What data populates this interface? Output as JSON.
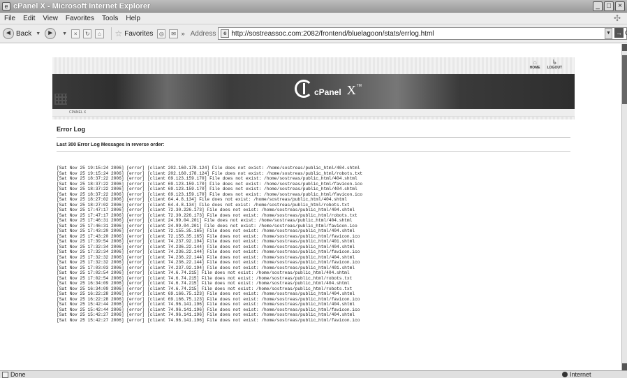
{
  "window": {
    "title": "cPanel X - Microsoft Internet Explorer"
  },
  "menu": [
    "File",
    "Edit",
    "View",
    "Favorites",
    "Tools",
    "Help"
  ],
  "toolbar": {
    "back_label": "Back",
    "favorites_label": "Favorites",
    "address_label": "Address",
    "url": "http://sostreassoc.com:2082/frontend/bluelagoon/stats/errlog.html",
    "go_label": "Go"
  },
  "status": {
    "text": "Done",
    "zone": "Internet"
  },
  "cpanel": {
    "home_label": "HOME",
    "logout_label": "LOGOUT",
    "logo_word": "cPanel",
    "logo_x": "X",
    "logo_tm": "TM",
    "breadcrumb": "CPANEL X",
    "heading": "Error Log",
    "subheading": "Last 300 Error Log Messages in reverse order:"
  },
  "log_lines": [
    "[Sat Nov 25 19:15:24 2006] [error] [client 202.160.178.124] File does not exist: /home/sostreas/public_html/404.shtml",
    "[Sat Nov 25 19:15:24 2006] [error] [client 202.160.178.124] File does not exist: /home/sostreas/public_html/robots.txt",
    "[Sat Nov 25 18:37:22 2006] [error] [client 69.123.159.170] File does not exist: /home/sostreas/public_html/404.shtml",
    "[Sat Nov 25 18:37:22 2006] [error] [client 69.123.159.170] File does not exist: /home/sostreas/public_html/favicon.ico",
    "[Sat Nov 25 18:37:22 2006] [error] [client 69.123.159.170] File does not exist: /home/sostreas/public_html/404.shtml",
    "[Sat Nov 25 18:37:22 2006] [error] [client 69.123.159.170] File does not exist: /home/sostreas/public_html/favicon.ico",
    "[Sat Nov 25 18:27:02 2006] [error] [client 64.4.8.134] File does not exist: /home/sostreas/public_html/404.shtml",
    "[Sat Nov 25 18:27:02 2006] [error] [client 64.4.8.134] File does not exist: /home/sostreas/public_html/robots.txt",
    "[Sat Nov 25 17:47:17 2006] [error] [client 72.30.226.173] File does not exist: /home/sostreas/public_html/404.shtml",
    "[Sat Nov 25 17:47:17 2006] [error] [client 72.30.226.173] File does not exist: /home/sostreas/public_html/robots.txt",
    "[Sat Nov 25 17:46:31 2006] [error] [client 24.99.04.201] File does not exist: /home/sostreas/public_html/404.shtml",
    "[Sat Nov 25 17:46:31 2006] [error] [client 24.99.04.201] File does not exist: /home/sostreas/public_html/favicon.ico",
    "[Sat Nov 25 17:43:20 2006] [error] [client 72.155.35.165] File does not exist: /home/sostreas/public_html/404.shtml",
    "[Sat Nov 25 17:43:20 2006] [error] [client 72.155.35.165] File does not exist: /home/sostreas/public_html/favicon.ico",
    "[Sat Nov 25 17:39:54 2006] [error] [client 74.237.92.194] File does not exist: /home/sostreas/public_html/401.shtml",
    "[Sat Nov 25 17:32:34 2006] [error] [client 74.236.22.144] File does not exist: /home/sostreas/public_html/404.shtml",
    "[Sat Nov 25 17:32:34 2006] [error] [client 74.236.22.144] File does not exist: /home/sostreas/public_html/favicon.ico",
    "[Sat Nov 25 17:32:32 2006] [error] [client 74.236.22.144] File does not exist: /home/sostreas/public_html/404.shtml",
    "[Sat Nov 25 17:32:32 2006] [error] [client 74.236.22.144] File does not exist: /home/sostreas/public_html/favicon.ico",
    "[Sat Nov 25 17:03:03 2006] [error] [client 74.237.92.194] File does not exist: /home/sostreas/public_html/401.shtml",
    "[Sat Nov 25 17:02:54 2006] [error] [client 74.6.74.215] File does not exist: /home/sostreas/public_html/404.shtml",
    "[Sat Nov 25 17:02:54 2006] [error] [client 74.6.74.215] File does not exist: /home/sostreas/public_html/robots.txt",
    "[Sat Nov 25 16:34:09 2006] [error] [client 74.6.74.215] File does not exist: /home/sostreas/public_html/404.shtml",
    "[Sat Nov 25 16:34:09 2006] [error] [client 74.6.74.215] File does not exist: /home/sostreas/public_html/robots.txt",
    "[Sat Nov 25 16:22:28 2006] [error] [client 69.166.75.123] File does not exist: /home/sostreas/public_html/404.shtml",
    "[Sat Nov 25 16:22:28 2006] [error] [client 69.166.75.123] File does not exist: /home/sostreas/public_html/favicon.ico",
    "[Sat Nov 25 15:42:44 2006] [error] [client 74.96.141.196] File does not exist: /home/sostreas/public_html/404.shtml",
    "[Sat Nov 25 15:42:44 2006] [error] [client 74.96.141.196] File does not exist: /home/sostreas/public_html/favicon.ico",
    "[Sat Nov 25 15:42:27 2006] [error] [client 74.96.141.196] File does not exist: /home/sostreas/public_html/404.shtml",
    "[Sat Nov 25 15:42:27 2006] [error] [client 74.96.141.196] File does not exist: /home/sostreas/public_html/favicon.ico"
  ]
}
